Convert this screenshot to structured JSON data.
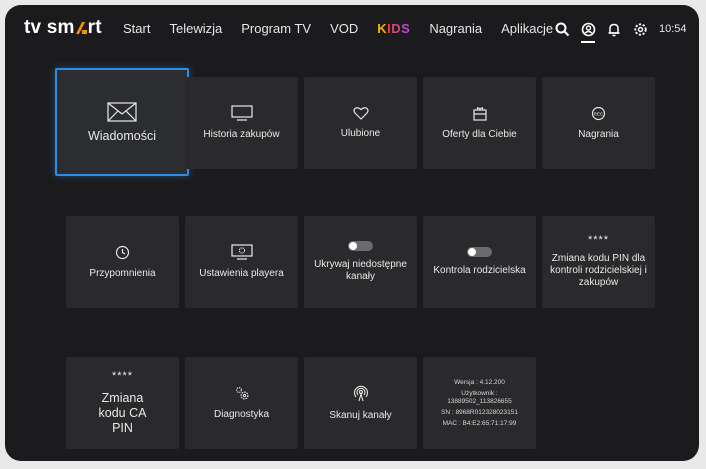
{
  "logo": {
    "text_left": "tv sm",
    "text_right": "rt"
  },
  "nav": {
    "items": [
      "Start",
      "Telewizja",
      "Program TV",
      "VOD"
    ],
    "kids": [
      "K",
      "I",
      "D",
      "S"
    ],
    "items_after": [
      "Nagrania",
      "Aplikacje"
    ]
  },
  "header_icons": [
    "search-icon",
    "profile-icon",
    "bell-icon",
    "gear-icon"
  ],
  "clock": "10:54",
  "colors": {
    "accent": "#2f8be6",
    "logo_orange": "#f39200"
  },
  "tiles": {
    "messages": "Wiadomości",
    "purchase_history": "Historia zakupów",
    "favorites": "Ulubione",
    "offers": "Oferty dla Ciebie",
    "recordings": "Nagrania",
    "reminders": "Przypomnienia",
    "player_settings": "Ustawienia playera",
    "hide_channels": "Ukrywaj niedostępne kanały",
    "parental_control": "Kontrola rodzicielska",
    "change_pin_parental": "Zmiana kodu PIN dla kontroli rodzicielskiej i zakupów",
    "pin_mask": "****",
    "change_ca_pin": "Zmiana kodu CA PIN",
    "diagnostics": "Diagnostyka",
    "scan_channels": "Skanuj kanały"
  },
  "device_info": {
    "version": "Wersja : 4.12.200",
    "user_label": "Użytkownik :",
    "user_value": "13889502_113826655",
    "sn": "SN : 8968R012328023151",
    "mac": "MAC : B4:E2:65:71:17:99"
  }
}
